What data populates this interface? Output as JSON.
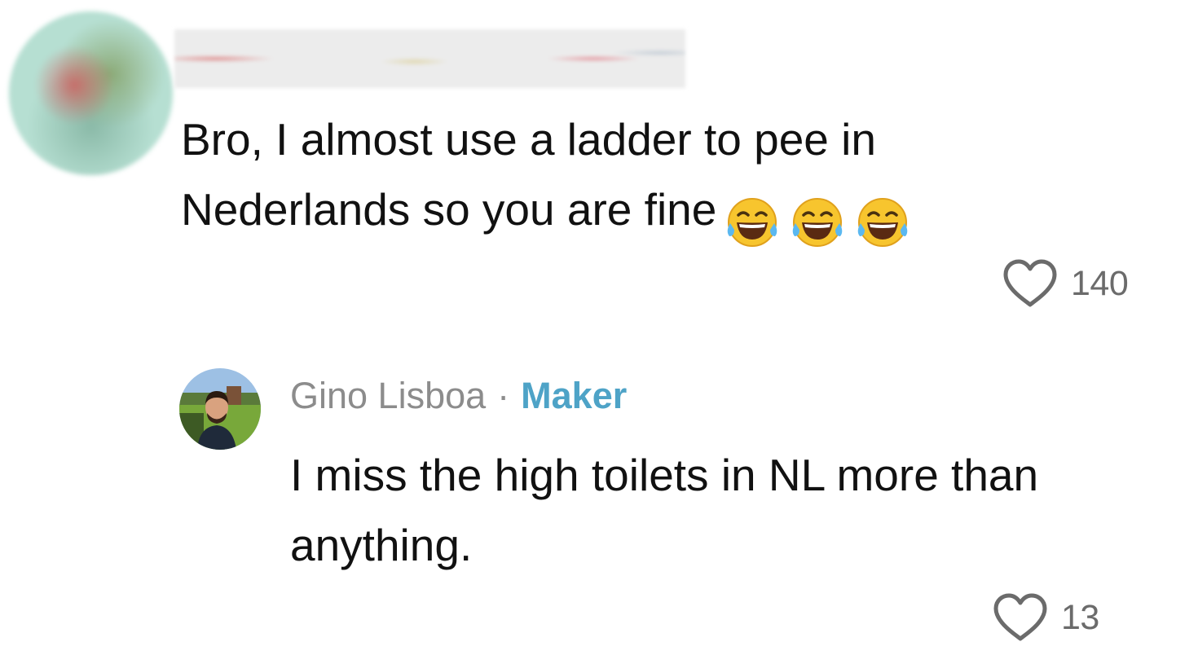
{
  "comment": {
    "avatar_icon": "blurred-avatar",
    "text": "Bro, I almost use a ladder to pee in Nederlands so you are fine",
    "emojis": [
      "face-with-tears-of-joy",
      "face-with-tears-of-joy",
      "face-with-tears-of-joy"
    ],
    "like_icon": "heart-outline-icon",
    "like_count": "140"
  },
  "reply": {
    "avatar_icon": "user-photo-avatar",
    "author": "Gino Lisboa",
    "separator": "·",
    "badge": "Maker",
    "text": "I miss the high toilets in NL more than anything.",
    "like_icon": "heart-outline-icon",
    "like_count": "13"
  },
  "colors": {
    "badge": "#4ea3c7",
    "muted": "#8c8c8c",
    "text": "#111111",
    "heart": "#6b6b6b"
  }
}
